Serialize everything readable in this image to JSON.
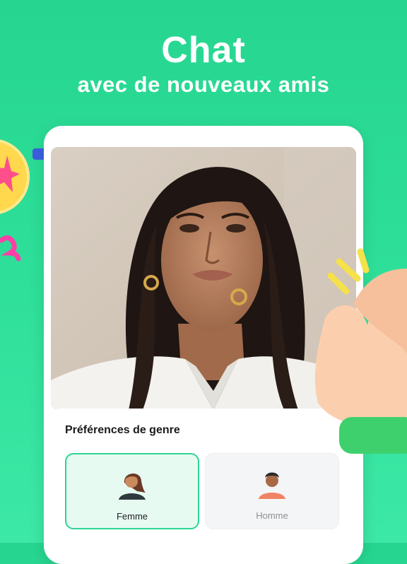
{
  "header": {
    "title": "Chat",
    "subtitle": "avec de nouveaux amis"
  },
  "profile_photo": {
    "icon": "portrait-photo"
  },
  "gender_preferences": {
    "title": "Préférences de genre",
    "options": [
      {
        "label": "Femme",
        "icon": "female-avatar-icon",
        "selected": true
      },
      {
        "label": "Homme",
        "icon": "male-avatar-icon",
        "selected": false
      }
    ]
  },
  "colors": {
    "background": "#2fe09a",
    "accent": "#2bd594",
    "selected_fill": "#e6faf2",
    "unselected_fill": "#f4f5f6"
  }
}
